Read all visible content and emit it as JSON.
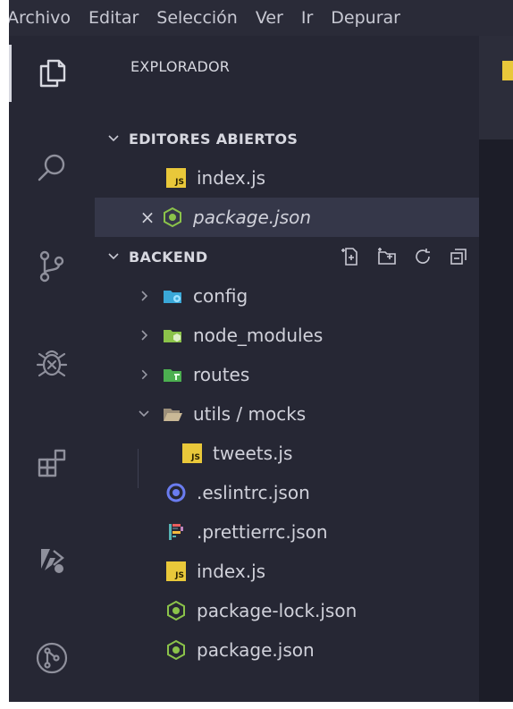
{
  "menubar": {
    "items": [
      "Archivo",
      "Editar",
      "Selección",
      "Ver",
      "Ir",
      "Depurar"
    ]
  },
  "activity_bar": {
    "icons": [
      "explorer-icon",
      "search-icon",
      "source-control-icon",
      "debug-icon",
      "extensions-icon",
      "remote-icon",
      "git-graph-icon"
    ],
    "active": "explorer-icon"
  },
  "sidebar": {
    "title": "EXPLORADOR",
    "open_editors": {
      "header": "EDITORES ABIERTOS",
      "items": [
        {
          "label": "index.js",
          "icon": "js-file-icon"
        },
        {
          "label": "package.json",
          "icon": "node-json-icon",
          "selected": true,
          "modified": true
        }
      ]
    },
    "project": {
      "header": "BACKEND",
      "actions": [
        "new-file-icon",
        "new-folder-icon",
        "refresh-icon",
        "collapse-all-icon"
      ],
      "folders": [
        {
          "label": "config",
          "icon": "config-folder-icon",
          "expanded": false
        },
        {
          "label": "node_modules",
          "icon": "node-folder-icon",
          "expanded": false
        },
        {
          "label": "routes",
          "icon": "routes-folder-icon",
          "expanded": false
        },
        {
          "label": "utils / mocks",
          "icon": "open-folder-icon",
          "expanded": true
        }
      ],
      "nested_files": [
        {
          "label": "tweets.js",
          "icon": "js-file-icon"
        }
      ],
      "files": [
        {
          "label": ".eslintrc.json",
          "icon": "eslint-icon"
        },
        {
          "label": ".prettierrc.json",
          "icon": "prettier-icon"
        },
        {
          "label": "index.js",
          "icon": "js-file-icon"
        },
        {
          "label": "package-lock.json",
          "icon": "node-json-icon"
        },
        {
          "label": "package.json",
          "icon": "node-json-icon"
        }
      ]
    }
  },
  "colors": {
    "background": "#1e1f2b",
    "sidebar": "#262734",
    "selected_row": "#353749",
    "js_badge": "#e9c83a",
    "node_green": "#8bc34a",
    "eslint_blue": "#6a7cf0"
  }
}
